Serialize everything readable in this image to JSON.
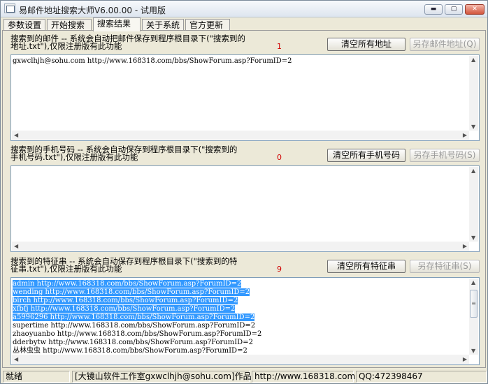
{
  "window": {
    "title": "易邮件地址搜索大师V6.00.00 - 试用版",
    "buttons": {
      "minimize": "▬",
      "maximize": "▢",
      "close": "✕"
    }
  },
  "tabs": [
    {
      "label": "参数设置",
      "active": false
    },
    {
      "label": "开始搜索",
      "active": false
    },
    {
      "label": "搜索结果",
      "active": true
    },
    {
      "label": "关于系统",
      "active": false
    },
    {
      "label": "官方更新",
      "active": false
    }
  ],
  "email_section": {
    "label_line1": "搜索到的邮件 -- 系统会自动把邮件保存到程序根目录下(\"搜索到的",
    "label_line2": "地址.txt\"),仅限注册版有此功能",
    "count": "1",
    "clear_button": "清空所有地址",
    "save_button": "另存邮件地址(Q)",
    "rows": [
      "gxwclhjh@sohu.com http://www.168318.com/bbs/ShowForum.asp?ForumID=2"
    ]
  },
  "phone_section": {
    "label_line1": "搜索到的手机号码 -- 系统会自动保存到程序根目录下(\"搜索到的",
    "label_line2": "手机号码.txt\"),仅限注册版有此功能",
    "count": "0",
    "clear_button": "清空所有手机号码",
    "save_button": "另存手机号码(S)",
    "rows": []
  },
  "feature_section": {
    "label_line1": "搜索到的特征串 -- 系统会自动保存到程序根目录下(\"搜索到的特",
    "label_line2": "征串.txt\"),仅限注册版有此功能",
    "count": "9",
    "clear_button": "清空所有特征串",
    "save_button": "另存特征串(S)",
    "rows": [
      {
        "text": "admin http://www.168318.com/bbs/ShowForum.asp?ForumID=2",
        "selected": true
      },
      {
        "text": "wending http://www.168318.com/bbs/ShowForum.asp?ForumID=2",
        "selected": true
      },
      {
        "text": "birch http://www.168318.com/bbs/ShowForum.asp?ForumID=2",
        "selected": true
      },
      {
        "text": "xfbfj http://www.168318.com/bbs/ShowForum.asp?ForumID=2",
        "selected": true
      },
      {
        "text": "a5996296 http://www.168318.com/bbs/ShowForum.asp?ForumID=2",
        "selected": true
      },
      {
        "text": "supertime http://www.168318.com/bbs/ShowForum.asp?ForumID=2",
        "selected": false
      },
      {
        "text": "zhaoyuanbo http://www.168318.com/bbs/ShowForum.asp?ForumID=2",
        "selected": false
      },
      {
        "text": "dderbytw http://www.168318.com/bbs/ShowForum.asp?ForumID=2",
        "selected": false
      },
      {
        "text": "丛林虫虫 http://www.168318.com/bbs/ShowForum.asp?ForumID=2",
        "selected": false
      }
    ]
  },
  "status_bar": {
    "state": "就绪",
    "author": "[大镜山软件工作室gxwclhjh@sohu.com]作品",
    "website": "http://www.168318.com",
    "qq": "QQ:472398467"
  },
  "colors": {
    "selection": "#3399ff",
    "count": "#d00000"
  }
}
